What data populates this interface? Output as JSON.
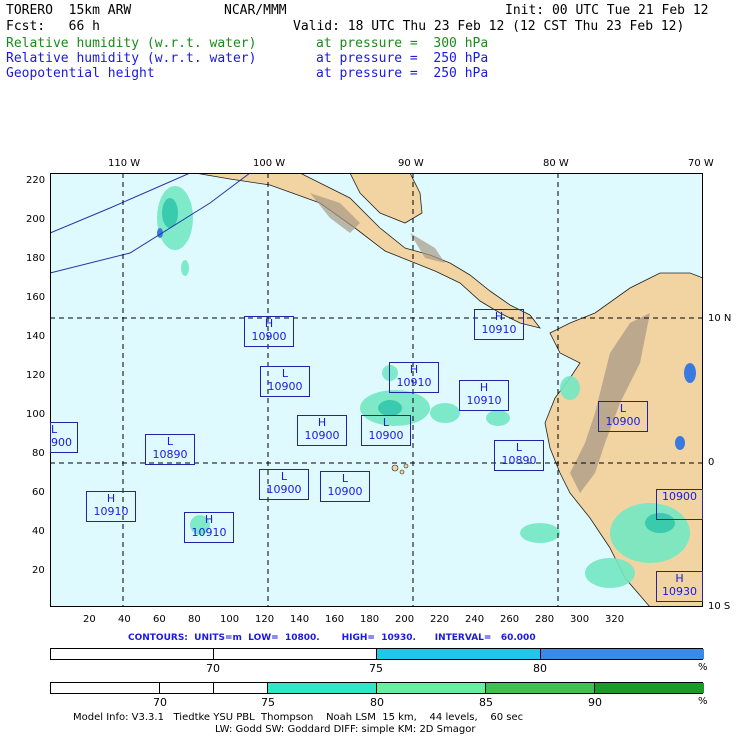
{
  "header": {
    "model": "TORERO  15km ARW",
    "org": "NCAR/MMM",
    "init": "Init: 00 UTC Tue 21 Feb 12",
    "fcst": "Fcst:   66 h",
    "valid": "Valid: 18 UTC Thu 23 Feb 12 (12 CST Thu 23 Feb 12)",
    "fields": [
      {
        "name": "Relative humidity (w.r.t. water)",
        "level": "at pressure =  300 hPa",
        "color": "#1a8a1a"
      },
      {
        "name": "Relative humidity (w.r.t. water)",
        "level": "at pressure =  250 hPa",
        "color": "#1a1ae0"
      },
      {
        "name": "Geopotential height",
        "level": "at pressure =  250 hPa",
        "color": "#1a1ae0"
      }
    ]
  },
  "map": {
    "top_ticks": [
      "110 W",
      "100 W",
      "90 W",
      "80 W",
      "70 W"
    ],
    "right_ticks": [
      "10 N",
      "0",
      "10 S"
    ],
    "y_ticks": [
      "220",
      "200",
      "180",
      "160",
      "140",
      "120",
      "100",
      "80",
      "60",
      "40",
      "20"
    ],
    "x_ticks": [
      "20",
      "40",
      "60",
      "80",
      "100",
      "120",
      "140",
      "160",
      "180",
      "200",
      "220",
      "240",
      "260",
      "280",
      "300",
      "320"
    ],
    "colors": {
      "ocean": "#dffaff",
      "land": "#f2d4a2",
      "terrain": "#a89a86",
      "rh_light": "#74e8c4",
      "rh_mid": "#2ec4a8",
      "rh_blue": "#3a7ae0"
    },
    "highs_lows": [
      {
        "type": "H",
        "value": "10900"
      },
      {
        "type": "L",
        "value": "10900"
      },
      {
        "type": "H",
        "value": "10910"
      },
      {
        "type": "H",
        "value": "10910"
      },
      {
        "type": "H",
        "value": "10910"
      },
      {
        "type": "L",
        "value": "10890"
      },
      {
        "type": "H",
        "value": "10900"
      },
      {
        "type": "L",
        "value": "10900"
      },
      {
        "type": "L",
        "value": "10900"
      },
      {
        "type": "L",
        "value": "10890"
      },
      {
        "type": "L",
        "value": "10900"
      },
      {
        "type": "L",
        "value": "10900"
      },
      {
        "type": "H",
        "value": "10910"
      },
      {
        "type": "H",
        "value": "10910"
      },
      {
        "type": "L",
        "value": "900"
      },
      {
        "type": "",
        "value": "10900"
      },
      {
        "type": "H",
        "value": "10930"
      }
    ]
  },
  "contours": {
    "text": "CONTOURS:  UNITS=m  LOW=  10800.       HIGH=  10930.      INTERVAL=   60.000"
  },
  "legend1": {
    "labels": [
      "70",
      "75",
      "80"
    ],
    "unit": "%",
    "colors": [
      "#ffffff",
      "#ffffff",
      "#1ec8e6",
      "#3a8ae8"
    ]
  },
  "legend2": {
    "labels": [
      "70",
      "75",
      "80",
      "85",
      "90"
    ],
    "unit": "%",
    "colors": [
      "#ffffff",
      "#ffffff",
      "#ffffff",
      "#2ee6c8",
      "#66f0a0",
      "#40c050",
      "#1a9a28"
    ]
  },
  "footer": {
    "line1": "Model Info: V3.3.1   Tiedtke YSU PBL  Thompson    Noah LSM  15 km,    44 levels,    60 sec",
    "line2": "LW: Godd SW: Goddard DIFF: simple KM: 2D Smagor"
  }
}
